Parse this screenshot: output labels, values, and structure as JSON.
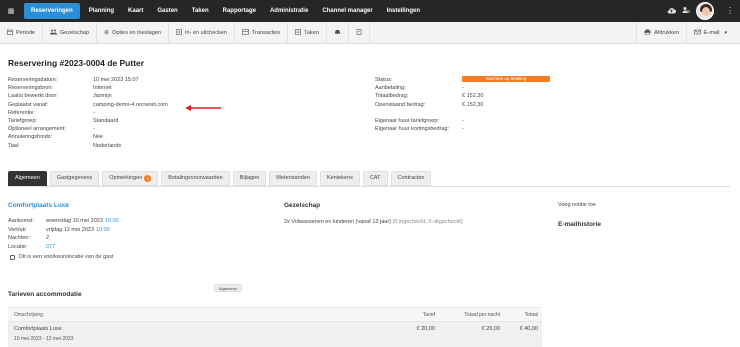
{
  "nav": {
    "items": [
      "Reserveringen",
      "Planning",
      "Kaart",
      "Gasten",
      "Taken",
      "Rapportage",
      "Administratie",
      "Channel manager",
      "Instellingen"
    ],
    "active_index": 0
  },
  "toolbar": {
    "left": [
      {
        "icon": "calendar-icon",
        "label": "Periode"
      },
      {
        "icon": "group-icon",
        "label": "Gezelschap"
      },
      {
        "icon": "plus-circle-icon",
        "label": "Opties en toeslagen"
      },
      {
        "icon": "checkin-icon",
        "label": "In- en uitchecken"
      },
      {
        "icon": "list-icon",
        "label": "Transacties"
      },
      {
        "icon": "task-icon",
        "label": "Taken"
      },
      {
        "icon": "car-icon",
        "label": ""
      },
      {
        "icon": "document-icon",
        "label": ""
      }
    ],
    "right": [
      {
        "icon": "printer-icon",
        "label": "Afdrukken"
      },
      {
        "icon": "email-icon",
        "label": "E-mail"
      }
    ]
  },
  "title": "Reservering #2023-0004 de Putter",
  "info_left": [
    {
      "label": "Reserveringsdatum:",
      "value": "10 mei 2023 15:07"
    },
    {
      "label": "Reserveringsbron:",
      "value": "Internet"
    },
    {
      "label": "Laatst bewerkt door:",
      "value": "Jasmijn"
    },
    {
      "label": "Geplaatst vanaf:",
      "value": "camping-demo-4.recranet.com"
    },
    {
      "label": "Referentie:",
      "value": "-"
    },
    {
      "label": "Tariefgroep:",
      "value": "Standaard"
    },
    {
      "label": "Optioneel arrangement:",
      "value": "-"
    },
    {
      "label": "Annuleringsfonds:",
      "value": "Nee"
    },
    {
      "label": "Taal:",
      "value": "Nederlands"
    }
  ],
  "info_right": [
    {
      "label": "Status:",
      "value": "Wachten op betaling"
    },
    {
      "label": "Aanbetaling:",
      "value": "-"
    },
    {
      "label": "Totaalbedrag:",
      "value": "€ 152,30"
    },
    {
      "label": "Openstaand bedrag:",
      "value": "€ 152,30"
    },
    {
      "label": "",
      "value": ""
    },
    {
      "label": "Eigenaar huur tariefgroep:",
      "value": "-"
    },
    {
      "label": "Eigenaar huur kortingsbedrag:",
      "value": "-"
    }
  ],
  "tabs": [
    {
      "label": "Algemeen",
      "badge": ""
    },
    {
      "label": "Gastgegevens",
      "badge": ""
    },
    {
      "label": "Opmerkingen",
      "badge": "1"
    },
    {
      "label": "Betalingsvoorwaarden",
      "badge": ""
    },
    {
      "label": "Bijlagen",
      "badge": ""
    },
    {
      "label": "Meterstanden",
      "badge": ""
    },
    {
      "label": "Kentekens",
      "badge": ""
    },
    {
      "label": "CAT",
      "badge": ""
    },
    {
      "label": "Contracten",
      "badge": ""
    }
  ],
  "stay": {
    "title": "Comfortplaats Luxe",
    "arrival_label": "Aankomst:",
    "arrival_date": "woensdag 10 mei 2023",
    "arrival_time": "15:00",
    "departure_label": "Vertrek:",
    "departure_date": "vrijdag 12 mei 2023",
    "departure_time": "10:00",
    "nights_label": "Nachten:",
    "nights": "2",
    "location_label": "Locatie:",
    "location": "077",
    "preference": "Dit is een voorkeurslocatie van de gast"
  },
  "guests": {
    "title": "Gezelschap",
    "line": "2x Volwassenen en kinderen (vanaf 13 jaar)",
    "checked": "(0 ingecheckt, 0 uitgecheckt)"
  },
  "side": {
    "note_link": "Voeg notitie toe",
    "email_history": "E-mailhistorie"
  },
  "rates": {
    "title": "Tarieven accommodatie",
    "chip": "Algemeen",
    "headers": [
      "Omschrijving",
      "Tarief",
      "Totaal per nacht",
      "Totaal"
    ],
    "rows": [
      {
        "desc": "Comfortplaats Luxe",
        "sub": "10 mei 2023 - 12 mei 2023",
        "tarief": "€ 20,00",
        "per_nacht": "€ 20,00",
        "totaal": "€ 40,00"
      }
    ]
  }
}
